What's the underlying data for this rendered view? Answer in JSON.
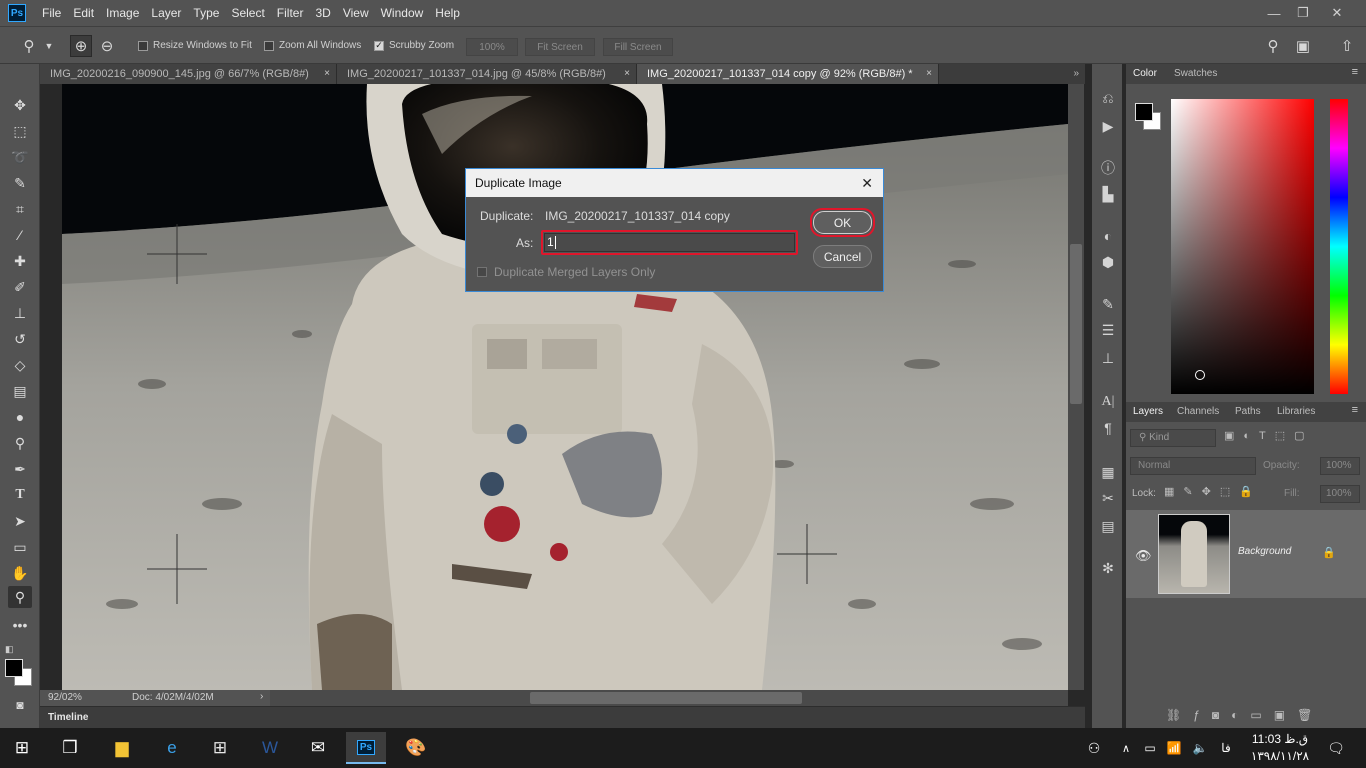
{
  "app": {
    "logo": "Ps",
    "accent": "#31a8ff"
  },
  "menu": [
    "File",
    "Edit",
    "Image",
    "Layer",
    "Type",
    "Select",
    "Filter",
    "3D",
    "View",
    "Window",
    "Help"
  ],
  "window_controls": {
    "minimize": "—",
    "restore": "❐",
    "close": "✕"
  },
  "options": {
    "resize_windows": "Resize Windows to Fit",
    "zoom_all": "Zoom All Windows",
    "scrubby_zoom": "Scrubby Zoom",
    "zoom_100": "100%",
    "fit_screen": "Fit Screen",
    "fill_screen": "Fill Screen"
  },
  "tabs": [
    {
      "label": "IMG_20200216_090900_145.jpg @ 66/7% (RGB/8#)",
      "close": "×"
    },
    {
      "label": "IMG_20200217_101337_014.jpg @ 45/8% (RGB/8#)",
      "close": "×"
    },
    {
      "label": "IMG_20200217_101337_014 copy @ 92% (RGB/8#) *",
      "close": "×"
    }
  ],
  "status": {
    "zoom": "92/02%",
    "doc": "Doc: 4/02M/4/02M",
    "arrow": "›"
  },
  "timeline": {
    "label": "Timeline"
  },
  "color_panel": {
    "tabs": [
      "Color",
      "Swatches"
    ]
  },
  "layers_panel": {
    "tabs": [
      "Layers",
      "Channels",
      "Paths",
      "Libraries"
    ],
    "filter_kind": "Kind",
    "blend_mode": "Normal",
    "opacity_label": "Opacity:",
    "opacity_value": "100%",
    "lock_label": "Lock:",
    "fill_label": "Fill:",
    "fill_value": "100%",
    "layer_name": "Background"
  },
  "dialog": {
    "title": "Duplicate Image",
    "close": "✕",
    "duplicate_label": "Duplicate:",
    "duplicate_value": "IMG_20200217_101337_014 copy",
    "as_label": "As:",
    "as_value": "1",
    "merged_label": "Duplicate Merged Layers Only",
    "ok": "OK",
    "cancel": "Cancel"
  },
  "taskbar": {
    "lang": "فا",
    "time": "11:03 ق.ظ",
    "date": "۱۳۹۸/۱۱/۲۸"
  }
}
